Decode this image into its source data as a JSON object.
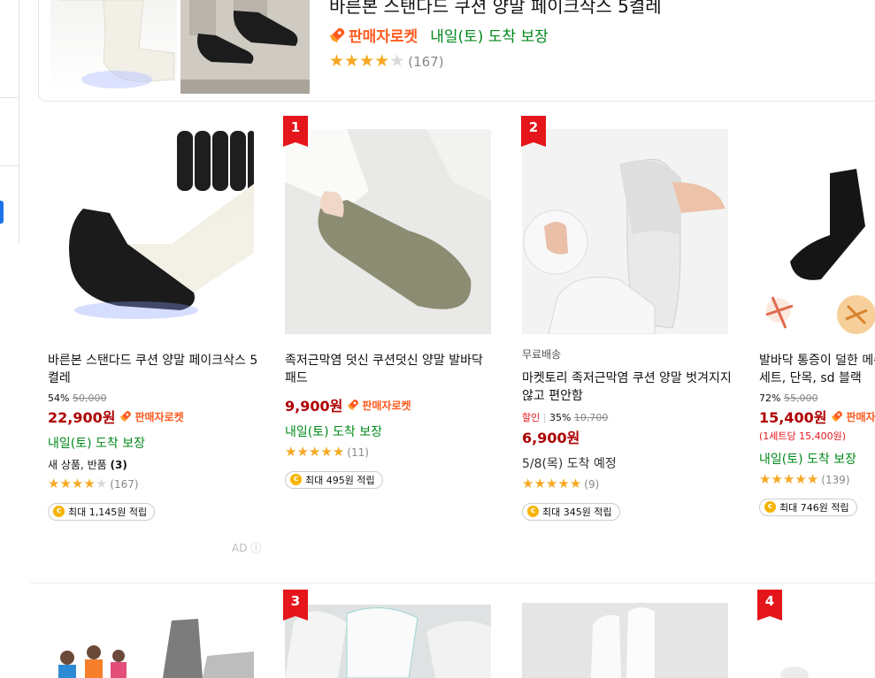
{
  "top_product": {
    "title": "바른본 스탠다드 쿠션 양말 페이크삭스 5켤레",
    "rocket_label": "판매자로켓",
    "delivery": "내일(토) 도착 보장",
    "rating": 4,
    "review_count": "(167)"
  },
  "products": [
    {
      "name": "바른본 스탠다드 쿠션 양말 페이크삭스 5켤레",
      "discount_rate": "54%",
      "original_price": "50,000",
      "price": "22,900원",
      "rocket_label": "판매자로켓",
      "delivery": "내일(토) 도착 보장",
      "return_text": "새 상품, 반품",
      "return_count": "(3)",
      "rating": 4,
      "review_count": "(167)",
      "points": "최대 1,145원 적립",
      "ad_label": "AD"
    },
    {
      "rank": "1",
      "name": "족저근막염 덧신 쿠션덧신 양말 발바닥 패드",
      "price": "9,900원",
      "rocket_label": "판매자로켓",
      "delivery": "내일(토) 도착 보장",
      "rating": 4.5,
      "review_count": "(11)",
      "points": "최대 495원 적립"
    },
    {
      "rank": "2",
      "free_shipping": "무료배송",
      "name": "마켓토리 족저근막염 쿠션 양말 벗겨지지않고 편안함",
      "sale_tag": "할인",
      "discount_rate": "35%",
      "original_price": "10,700",
      "price": "6,900원",
      "delivery": "5/8(목) 도착 예정",
      "rating": 4.5,
      "review_count": "(9)",
      "points": "최대 345원 적립"
    },
    {
      "name": "발바닥 통증이 덜한 메쉬 스포츠 양말 한세트, 단목, sd 블랙",
      "discount_rate": "72%",
      "original_price": "55,000",
      "price": "15,400원",
      "rocket_label": "판매자로켓",
      "unit_price": "(1세트당 15,400원)",
      "delivery": "내일(토) 도착 보장",
      "rating": 4.5,
      "review_count": "(139)",
      "points": "최대 746원 적립"
    }
  ],
  "next_row": {
    "ranks": [
      "3",
      "4"
    ]
  },
  "colors": {
    "price_red": "#ae0000",
    "rocket_orange": "#ff5a1f",
    "delivery_green": "#00891a",
    "rank_red": "#e4161b",
    "star_gold": "#f7a823"
  }
}
